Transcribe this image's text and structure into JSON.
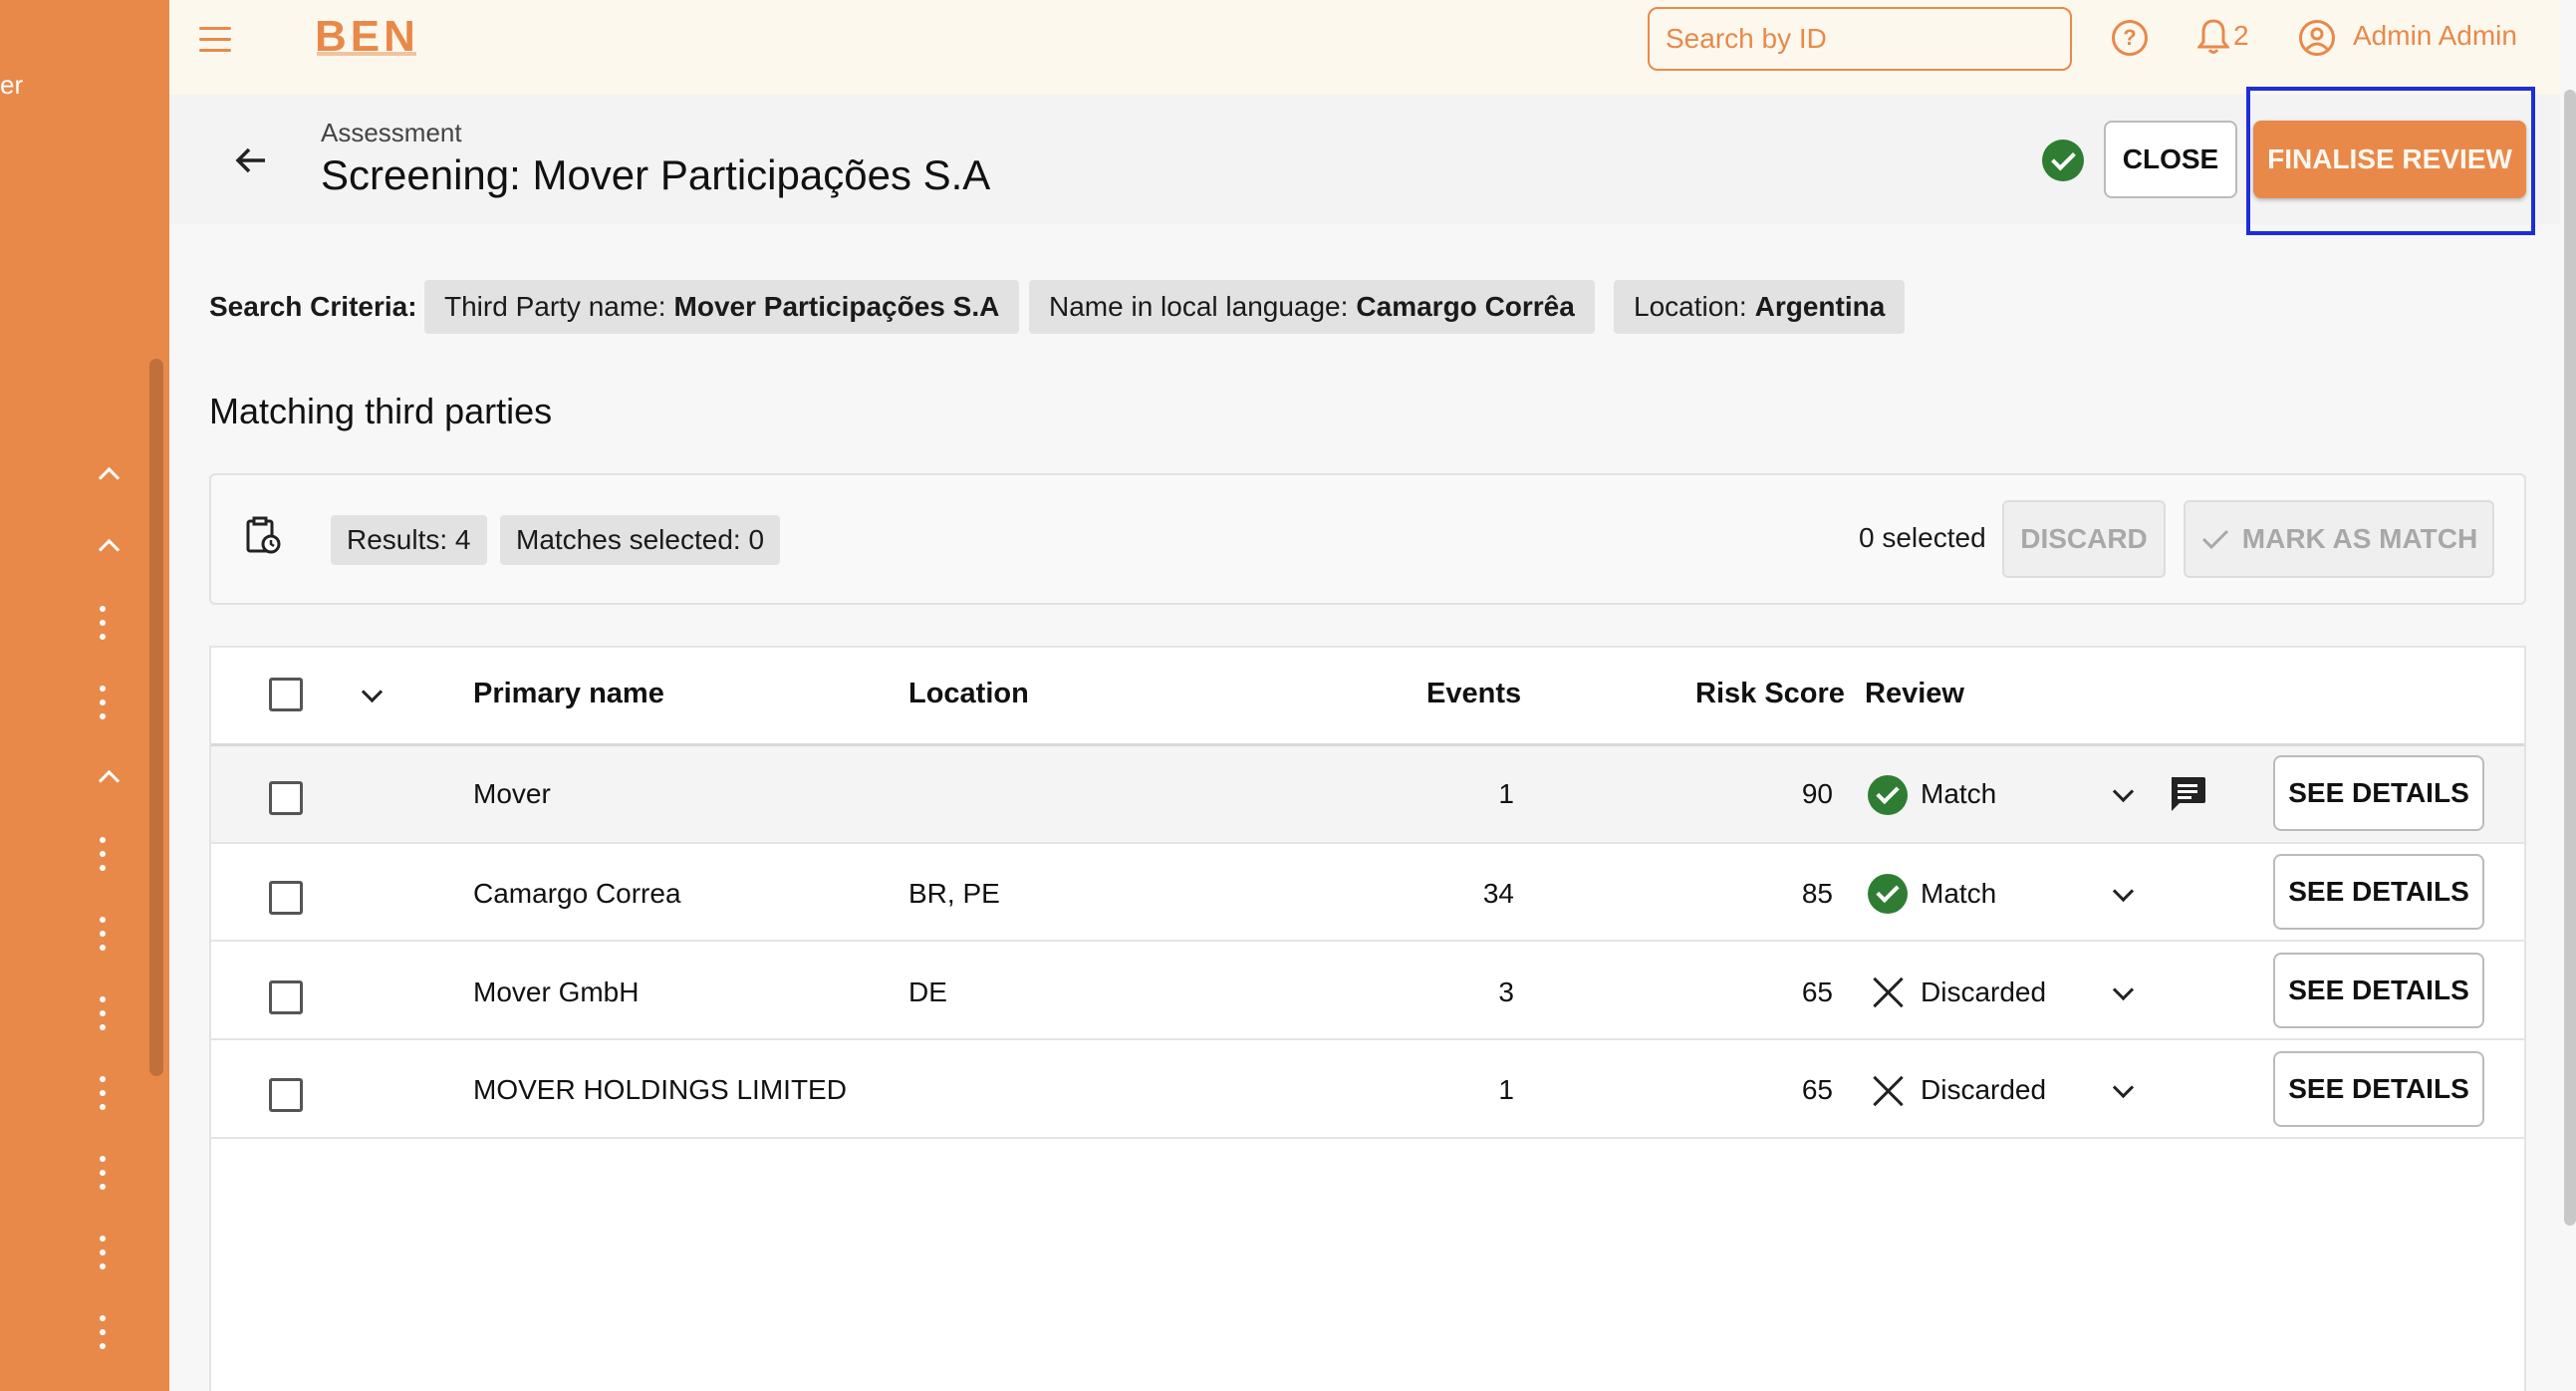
{
  "sidebar": {
    "partial_text": "er"
  },
  "topbar": {
    "logo": "BEN",
    "search_placeholder": "Search by ID",
    "notification_count": "2",
    "user_name": "Admin Admin"
  },
  "header": {
    "breadcrumb": "Assessment",
    "title": "Screening: Mover Participações S.A",
    "close_label": "CLOSE",
    "finalise_label": "FINALISE REVIEW"
  },
  "criteria": {
    "label": "Search Criteria:",
    "chips": [
      {
        "key": "Third Party name:",
        "value": "Mover Participações S.A"
      },
      {
        "key": "Name in local language:",
        "value": "Camargo Corrêa"
      },
      {
        "key": "Location:",
        "value": "Argentina"
      }
    ]
  },
  "section_title": "Matching third parties",
  "toolbar": {
    "results": "Results: 4",
    "matches_selected": "Matches selected: 0",
    "selected_count": "0 selected",
    "discard_label": "DISCARD",
    "mark_match_label": "MARK AS MATCH"
  },
  "table": {
    "columns": {
      "name": "Primary name",
      "location": "Location",
      "events": "Events",
      "risk": "Risk Score",
      "review": "Review"
    },
    "rows": [
      {
        "name": "Mover",
        "location": "",
        "events": "1",
        "risk": "90",
        "review": "Match",
        "status": "match",
        "has_comment": true,
        "action": "SEE DETAILS"
      },
      {
        "name": "Camargo Correa",
        "location": "BR, PE",
        "events": "34",
        "risk": "85",
        "review": "Match",
        "status": "match",
        "has_comment": false,
        "action": "SEE DETAILS"
      },
      {
        "name": "Mover GmbH",
        "location": "DE",
        "events": "3",
        "risk": "65",
        "review": "Discarded",
        "status": "discarded",
        "has_comment": false,
        "action": "SEE DETAILS"
      },
      {
        "name": "MOVER HOLDINGS LIMITED",
        "location": "",
        "events": "1",
        "risk": "65",
        "review": "Discarded",
        "status": "discarded",
        "has_comment": false,
        "action": "SEE DETAILS"
      }
    ]
  },
  "colors": {
    "brand": "#e8894a",
    "match": "#2e7d32",
    "highlight": "#1e2ed6"
  }
}
